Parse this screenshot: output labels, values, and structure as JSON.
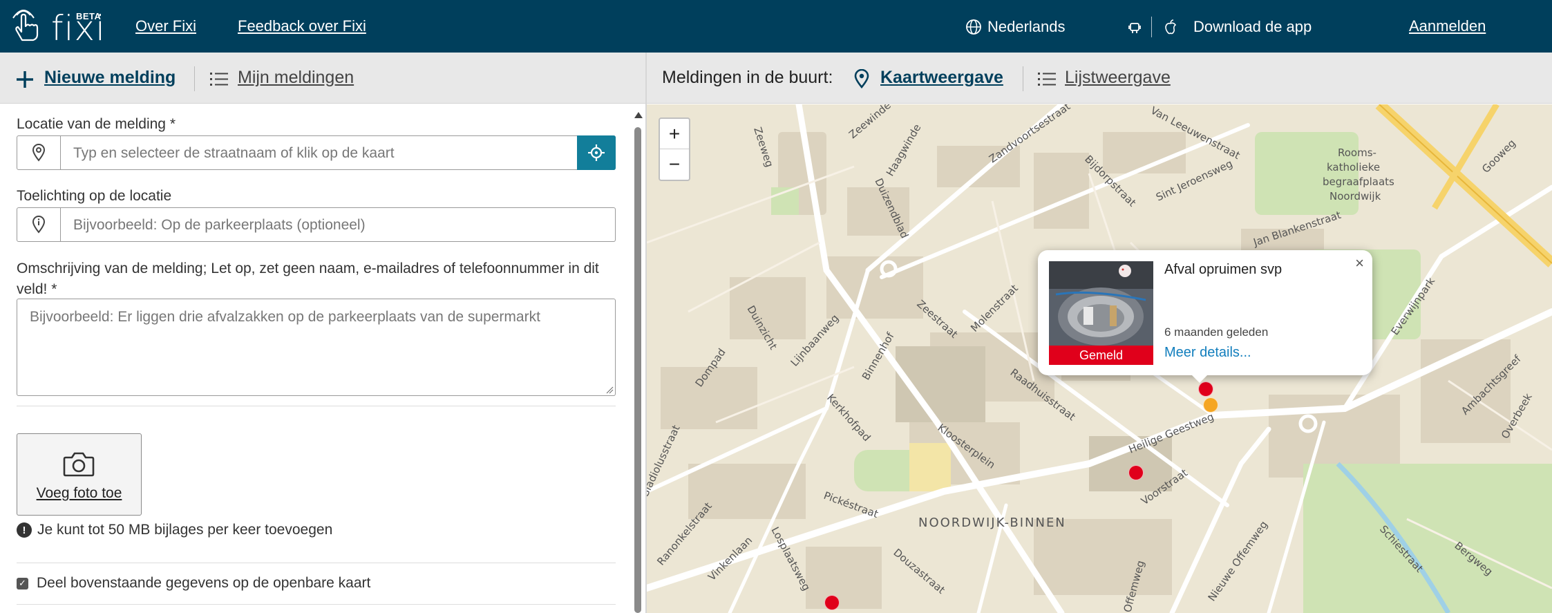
{
  "header": {
    "logo_word": "fixi",
    "logo_badge": "BETA",
    "nav": {
      "about": "Over Fixi",
      "feedback": "Feedback over Fixi"
    },
    "language": "Nederlands",
    "download": "Download de app",
    "login": "Aanmelden"
  },
  "subbar": {
    "new_report": "Nieuwe melding",
    "my_reports": "Mijn meldingen",
    "nearby_label": "Meldingen in de buurt:",
    "map_view": "Kaartweergave",
    "list_view": "Lijstweergave"
  },
  "form": {
    "location_label": "Locatie van de melding *",
    "location_placeholder": "Typ en selecteer de straatnaam of klik op de kaart",
    "location_note_label": "Toelichting op de locatie",
    "location_note_placeholder": "Bijvoorbeeld: Op de parkeerplaats (optioneel)",
    "description_label": "Omschrijving van de melding; Let op, zet geen naam, e-mailadres of telefoonnummer in dit veld! *",
    "description_placeholder": "Bijvoorbeeld: Er liggen drie afvalzakken op de parkeerplaats van de supermarkt",
    "photo_button": "Voeg foto toe",
    "attachment_note": "Je kunt tot 50 MB bijlages per keer toevoegen",
    "share_checkbox": "Deel bovenstaande gegevens op de openbare kaart",
    "share_checked": true
  },
  "map": {
    "zoom_in": "+",
    "zoom_out": "−",
    "district": "NOORDWIJK-BINNEN",
    "marker_colors": {
      "reported": "#e0001b",
      "in_progress": "#f5a623"
    },
    "streets": [
      "Van Leeuwenstraat",
      "Zandvoortsestraat",
      "Bijdorpstraat",
      "Sint Jeroensweg",
      "Jan Blankenstraat",
      "Duizendblad",
      "Haagwinde",
      "Zeewinde",
      "Zeestraat",
      "Molenstraat",
      "Raadhuisstraat",
      "Heilige Geestweg",
      "Kloosterplein",
      "Voorstraat",
      "Pickéstraat",
      "Douzastraat",
      "Lijnbaanweg",
      "Binnenhof",
      "Kerkhofpad",
      "Duinzicht",
      "Dompad",
      "Gladiolusstraat",
      "Ranonkelstraat",
      "Vinkenlaan",
      "Losplaatsweg",
      "Nieuwe Offemweg",
      "Offemweg",
      "Schiestraat",
      "Bergweg",
      "Ambachtsgreef",
      "Overbeek",
      "Everwijnpark",
      "Gooweg",
      "Rooms-katholieke begraafplaats Noordwijk"
    ],
    "popup": {
      "title": "Afval opruimen svp",
      "time": "6 maanden geleden",
      "status": "Gemeld",
      "more": "Meer details...",
      "close": "×"
    }
  }
}
